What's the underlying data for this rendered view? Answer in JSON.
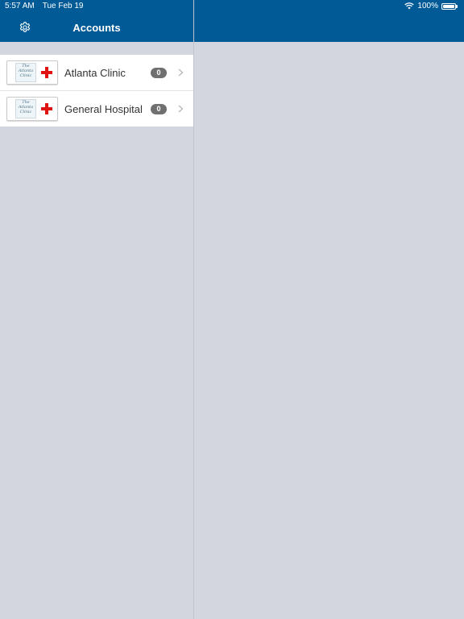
{
  "status_bar": {
    "time": "5:57 AM",
    "date": "Tue Feb 19",
    "battery_text": "100%",
    "battery_level": 1.0
  },
  "nav": {
    "title": "Accounts",
    "settings_icon": "gear-icon"
  },
  "accounts": [
    {
      "name": "Atlanta Clinic",
      "count": "0",
      "logo_text": "The Atlanta Clinic"
    },
    {
      "name": "General Hospital",
      "count": "0",
      "logo_text": "The Atlanta Clinic"
    }
  ],
  "colors": {
    "brand": "#005a96",
    "background": "#d3d6df",
    "badge": "#707070",
    "cross": "#e01313"
  }
}
